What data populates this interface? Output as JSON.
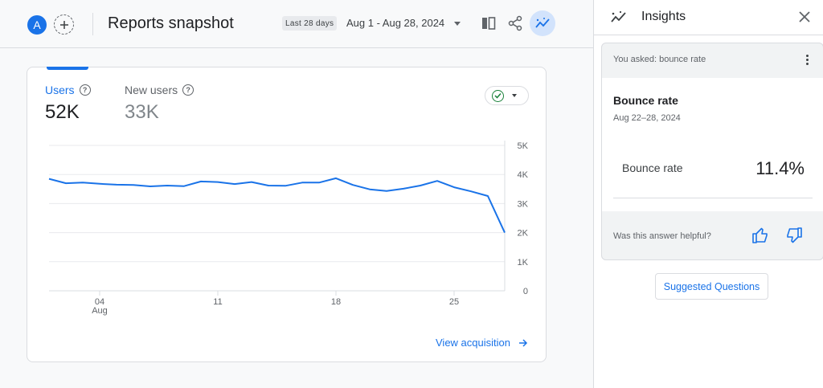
{
  "header": {
    "avatar_initial": "A",
    "title": "Reports snapshot",
    "date_chip": "Last 28 days",
    "date_range": "Aug 1 - Aug 28, 2024"
  },
  "card": {
    "metrics": [
      {
        "label": "Users",
        "value": "52K"
      },
      {
        "label": "New users",
        "value": "33K"
      }
    ],
    "view_link": "View acquisition"
  },
  "chart_data": {
    "type": "line",
    "title": "",
    "xlabel": "",
    "ylabel": "",
    "ylim": [
      0,
      5000
    ],
    "y_ticks": [
      0,
      1000,
      2000,
      3000,
      4000,
      5000
    ],
    "y_tick_labels": [
      "0",
      "1K",
      "2K",
      "3K",
      "4K",
      "5K"
    ],
    "x_tick_labels": [
      {
        "day": 4,
        "label": "04",
        "sub": "Aug"
      },
      {
        "day": 11,
        "label": "11",
        "sub": ""
      },
      {
        "day": 18,
        "label": "18",
        "sub": ""
      },
      {
        "day": 25,
        "label": "25",
        "sub": ""
      }
    ],
    "grid": true,
    "series": [
      {
        "color": "#1a73e8",
        "x": [
          1,
          2,
          3,
          4,
          5,
          6,
          7,
          8,
          9,
          10,
          11,
          12,
          13,
          14,
          15,
          16,
          17,
          18,
          19,
          20,
          21,
          22,
          23,
          24,
          25,
          26,
          27,
          28
        ],
        "values": [
          3850,
          3700,
          3720,
          3680,
          3650,
          3640,
          3590,
          3620,
          3600,
          3760,
          3740,
          3670,
          3740,
          3620,
          3610,
          3720,
          3720,
          3870,
          3640,
          3490,
          3430,
          3510,
          3620,
          3780,
          3560,
          3420,
          3260,
          2000
        ]
      }
    ]
  },
  "panel": {
    "title": "Insights",
    "asked": "You asked: bounce rate",
    "answer_title": "Bounce rate",
    "answer_date": "Aug 22–28, 2024",
    "metric_label": "Bounce rate",
    "metric_value": "11.4%",
    "helpful_prompt": "Was this answer helpful?"
  },
  "suggested_button": "Suggested Questions"
}
